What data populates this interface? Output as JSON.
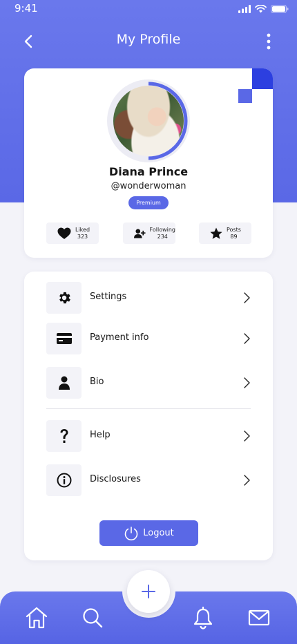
{
  "status_bar": {
    "time": "9:41"
  },
  "header": {
    "title": "My Profile"
  },
  "profile": {
    "name": "Diana Prince",
    "handle": "@wonderwoman",
    "badge": "Premium",
    "stats": [
      {
        "label": "Liked",
        "value": "323",
        "icon": "heart-icon"
      },
      {
        "label": "Following",
        "value": "234",
        "icon": "add-user-icon"
      },
      {
        "label": "Posts",
        "value": "89",
        "icon": "star-icon"
      }
    ]
  },
  "menu": {
    "items": [
      {
        "label": "Settings",
        "icon": "gear-icon"
      },
      {
        "label": "Payment info",
        "icon": "credit-card-icon"
      },
      {
        "label": "Bio",
        "icon": "person-icon"
      },
      {
        "label": "Help",
        "icon": "question-icon"
      },
      {
        "label": "Disclosures",
        "icon": "info-icon"
      }
    ],
    "logout_label": "Logout"
  },
  "bottom_nav": {
    "items": [
      "home-icon",
      "search-icon",
      "plus-icon",
      "bell-icon",
      "mail-icon"
    ]
  },
  "colors": {
    "accent": "#5a68e6",
    "accent_dark": "#2c3fe0",
    "background": "#f3f3f9",
    "card": "#ffffff"
  }
}
